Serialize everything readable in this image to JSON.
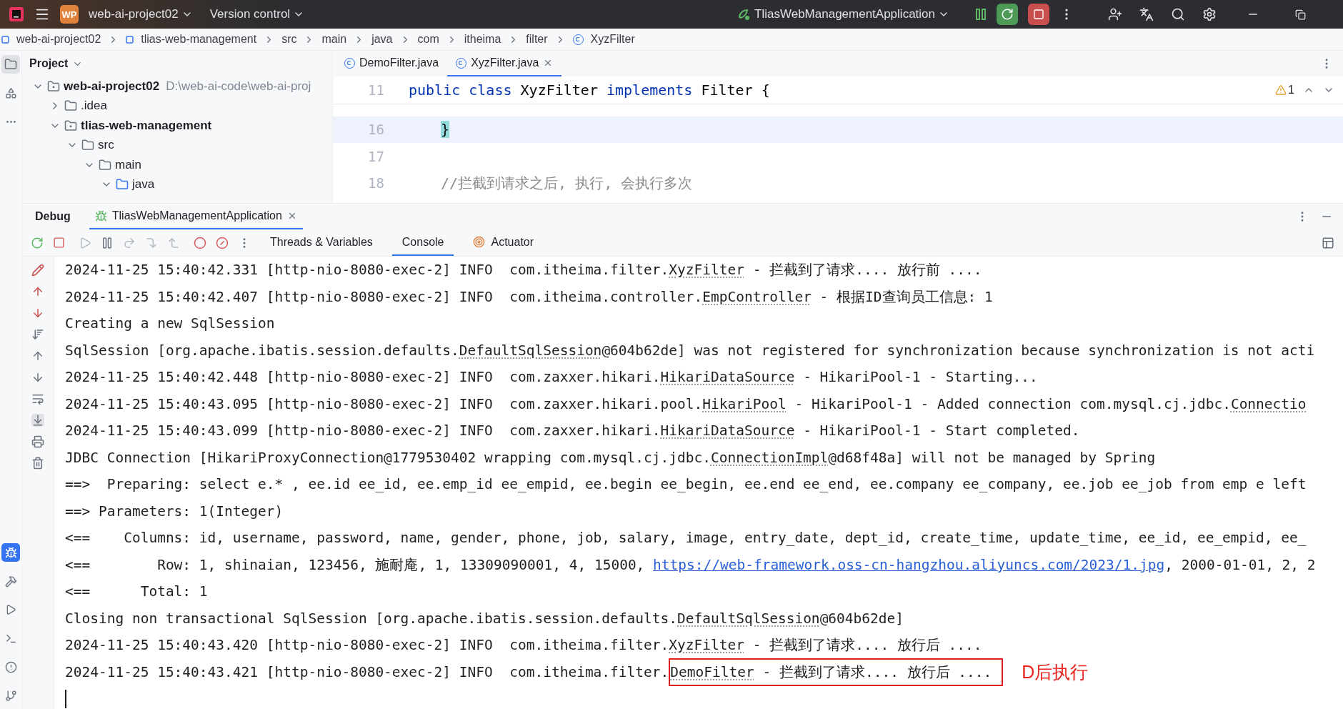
{
  "title_bar": {
    "project_badge": "WP",
    "project": "web-ai-project02",
    "vcs": "Version control",
    "run_config": "TliasWebManagementApplication"
  },
  "breadcrumbs": [
    {
      "label": "web-ai-project02",
      "kind": "module"
    },
    {
      "label": "tlias-web-management",
      "kind": "module"
    },
    {
      "label": "src",
      "kind": "plain"
    },
    {
      "label": "main",
      "kind": "plain"
    },
    {
      "label": "java",
      "kind": "plain"
    },
    {
      "label": "com",
      "kind": "plain"
    },
    {
      "label": "itheima",
      "kind": "plain"
    },
    {
      "label": "filter",
      "kind": "plain"
    },
    {
      "label": "XyzFilter",
      "kind": "class"
    }
  ],
  "project_panel": {
    "title": "Project",
    "tree": [
      {
        "label": "web-ai-project02",
        "path": "D:\\web-ai-code\\web-ai-proj",
        "kind": "module",
        "expanded": true,
        "children": [
          {
            "label": ".idea",
            "kind": "folder",
            "expanded": false
          },
          {
            "label": "tlias-web-management",
            "kind": "module",
            "expanded": true,
            "children": [
              {
                "label": "src",
                "kind": "folder",
                "expanded": true,
                "children": [
                  {
                    "label": "main",
                    "kind": "folder",
                    "expanded": true,
                    "children": [
                      {
                        "label": "java",
                        "kind": "source",
                        "expanded": true
                      }
                    ]
                  }
                ]
              }
            ]
          }
        ]
      }
    ]
  },
  "editor": {
    "tabs": [
      {
        "label": "DemoFilter.java",
        "selected": false
      },
      {
        "label": "XyzFilter.java",
        "selected": true
      }
    ],
    "warnings": "1",
    "sticky_line": {
      "number": "11",
      "indented": false,
      "current": false,
      "tokens": [
        {
          "kind": "keyword",
          "text": "public class "
        },
        {
          "kind": "plain",
          "text": "XyzFilter "
        },
        {
          "kind": "keyword",
          "text": "implements "
        },
        {
          "kind": "plain",
          "text": "Filter {"
        }
      ]
    },
    "lines": [
      {
        "number": "16",
        "indented": true,
        "current": true,
        "tokens": [
          {
            "kind": "matched",
            "text": "}"
          }
        ]
      },
      {
        "number": "17",
        "current": false
      },
      {
        "number": "18",
        "indented": true,
        "current": false,
        "tokens": [
          {
            "kind": "comment",
            "text": "//拦截到请求之后, 执行, 会执行多次"
          }
        ]
      }
    ]
  },
  "debug": {
    "title": "Debug",
    "session_tab": {
      "label": "TliasWebManagementApplication",
      "selected": true
    },
    "tabs": [
      {
        "label": "Threads & Variables",
        "kind": "plain",
        "selected": false
      },
      {
        "label": "Console",
        "kind": "plain",
        "selected": true
      },
      {
        "label": "Actuator",
        "kind": "icon",
        "selected": false
      }
    ],
    "console": [
      {
        "segments": [
          {
            "kind": "text",
            "text": "2024-11-25 15:40:42.331 [http-nio-8080-exec-2] INFO  com.itheima.filter."
          },
          {
            "kind": "ref",
            "text": "XyzFilter"
          },
          {
            "kind": "text",
            "text": " - 拦截到了请求.... 放行前 ...."
          }
        ]
      },
      {
        "segments": [
          {
            "kind": "text",
            "text": "2024-11-25 15:40:42.407 [http-nio-8080-exec-2] INFO  com.itheima.controller."
          },
          {
            "kind": "ref",
            "text": "EmpController"
          },
          {
            "kind": "text",
            "text": " - 根据ID查询员工信息: 1"
          }
        ]
      },
      {
        "segments": [
          {
            "kind": "text",
            "text": "Creating a new SqlSession"
          }
        ]
      },
      {
        "segments": [
          {
            "kind": "text",
            "text": "SqlSession [org.apache.ibatis.session.defaults."
          },
          {
            "kind": "ref",
            "text": "DefaultSqlSession"
          },
          {
            "kind": "text",
            "text": "@604b62de] was not registered for synchronization because synchronization is not acti"
          }
        ]
      },
      {
        "segments": [
          {
            "kind": "text",
            "text": "2024-11-25 15:40:42.448 [http-nio-8080-exec-2] INFO  com.zaxxer.hikari."
          },
          {
            "kind": "ref",
            "text": "HikariDataSource"
          },
          {
            "kind": "text",
            "text": " - HikariPool-1 - Starting..."
          }
        ]
      },
      {
        "segments": [
          {
            "kind": "text",
            "text": "2024-11-25 15:40:43.095 [http-nio-8080-exec-2] INFO  com.zaxxer.hikari.pool."
          },
          {
            "kind": "ref",
            "text": "HikariPool"
          },
          {
            "kind": "text",
            "text": " - HikariPool-1 - Added connection com.mysql.cj.jdbc."
          },
          {
            "kind": "ref",
            "text": "Connectio"
          }
        ]
      },
      {
        "segments": [
          {
            "kind": "text",
            "text": "2024-11-25 15:40:43.099 [http-nio-8080-exec-2] INFO  com.zaxxer.hikari."
          },
          {
            "kind": "ref",
            "text": "HikariDataSource"
          },
          {
            "kind": "text",
            "text": " - HikariPool-1 - Start completed."
          }
        ]
      },
      {
        "segments": [
          {
            "kind": "text",
            "text": "JDBC Connection [HikariProxyConnection@1779530402 wrapping com.mysql.cj.jdbc."
          },
          {
            "kind": "ref",
            "text": "ConnectionImpl"
          },
          {
            "kind": "text",
            "text": "@d68f48a] will not be managed by Spring"
          }
        ]
      },
      {
        "segments": [
          {
            "kind": "text",
            "text": "==>  Preparing: select e.* , ee.id ee_id, ee.emp_id ee_empid, ee.begin ee_begin, ee.end ee_end, ee.company ee_company, ee.job ee_job from emp e left"
          }
        ]
      },
      {
        "segments": [
          {
            "kind": "text",
            "text": "==> Parameters: 1(Integer)"
          }
        ]
      },
      {
        "segments": [
          {
            "kind": "text",
            "text": "<==    Columns: id, username, password, name, gender, phone, job, salary, image, entry_date, dept_id, create_time, update_time, ee_id, ee_empid, ee_"
          }
        ]
      },
      {
        "segments": [
          {
            "kind": "text",
            "text": "<==        Row: 1, shinaian, 123456, 施耐庵, 1, 13309090001, 4, 15000, "
          },
          {
            "kind": "link",
            "text": "https://web-framework.oss-cn-hangzhou.aliyuncs.com/2023/1.jpg"
          },
          {
            "kind": "text",
            "text": ", 2000-01-01, 2, 2"
          }
        ]
      },
      {
        "segments": [
          {
            "kind": "text",
            "text": "<==      Total: 1"
          }
        ]
      },
      {
        "segments": [
          {
            "kind": "text",
            "text": "Closing non transactional SqlSession [org.apache.ibatis.session.defaults."
          },
          {
            "kind": "ref",
            "text": "DefaultSqlSession"
          },
          {
            "kind": "text",
            "text": "@604b62de]"
          }
        ]
      },
      {
        "segments": [
          {
            "kind": "text",
            "text": "2024-11-25 15:40:43.420 [http-nio-8080-exec-2] INFO  com.itheima.filter."
          },
          {
            "kind": "ref",
            "text": "XyzFilter"
          },
          {
            "kind": "text",
            "text": " - 拦截到了请求.... 放行后 ...."
          }
        ]
      },
      {
        "segments": [
          {
            "kind": "text",
            "text": "2024-11-25 15:40:43.421 [http-nio-8080-exec-2] INFO  com.itheima.filter."
          },
          {
            "kind": "box",
            "segments": [
              {
                "kind": "ref",
                "text": "DemoFilter"
              },
              {
                "kind": "text",
                "text": " - 拦截到了请求.... 放行后 ...."
              }
            ]
          }
        ],
        "annotation": "D后执行"
      }
    ]
  }
}
